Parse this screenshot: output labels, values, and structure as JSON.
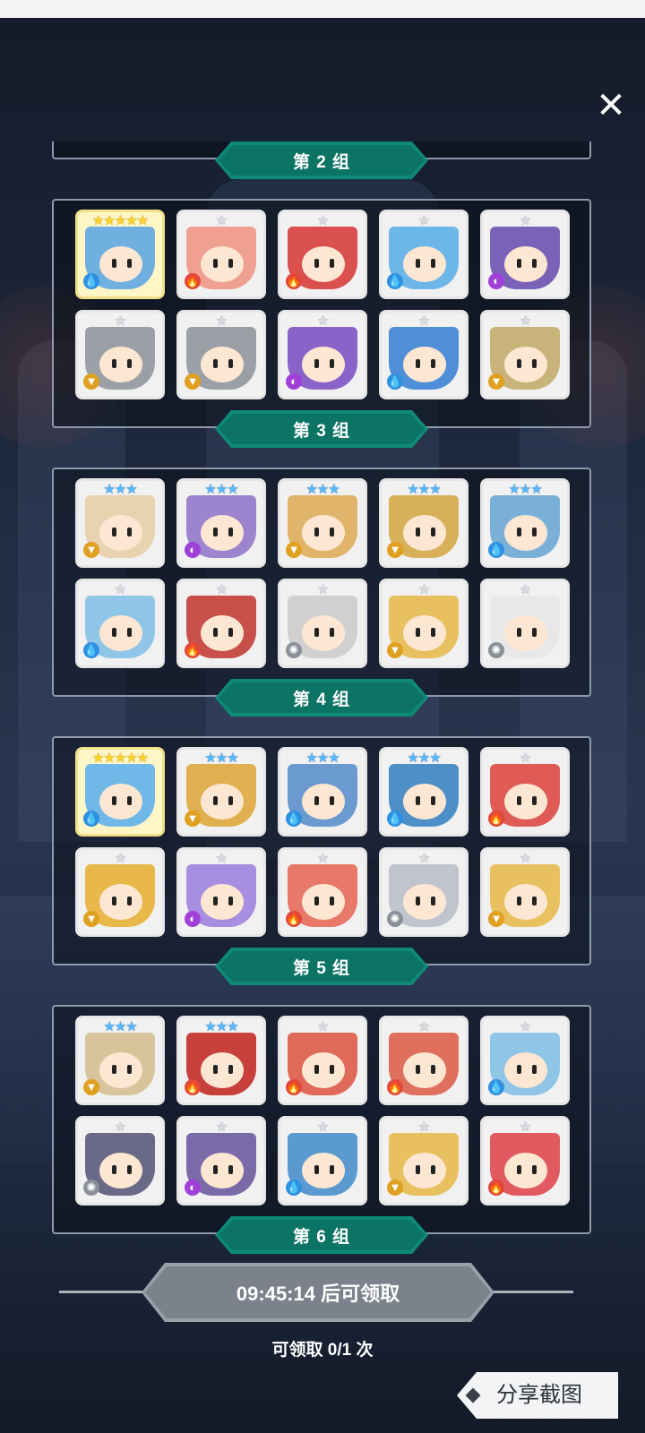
{
  "close_icon": "close-icon",
  "groups": [
    {
      "label": "第 2 组",
      "heroes": [
        {
          "stars": "★★★★★",
          "tier": "gold",
          "element": "water",
          "c": "#6fb0e0"
        },
        {
          "stars": "★",
          "tier": "silver",
          "element": "fire",
          "c": "#f0a090"
        },
        {
          "stars": "★",
          "tier": "silver",
          "element": "fire",
          "c": "#d9504e"
        },
        {
          "stars": "★",
          "tier": "silver",
          "element": "water",
          "c": "#6cb6e8"
        },
        {
          "stars": "★",
          "tier": "silver",
          "element": "dark",
          "c": "#7a62b8"
        },
        {
          "stars": "★",
          "tier": "silver",
          "element": "earth",
          "c": "#9aa0a6"
        },
        {
          "stars": "★",
          "tier": "silver",
          "element": "earth",
          "c": "#9aa0a6"
        },
        {
          "stars": "★",
          "tier": "silver",
          "element": "dark",
          "c": "#8a63c8"
        },
        {
          "stars": "★",
          "tier": "silver",
          "element": "water",
          "c": "#4f8fd8"
        },
        {
          "stars": "★",
          "tier": "silver",
          "element": "earth",
          "c": "#c8b47a"
        }
      ]
    },
    {
      "label": "第 3 组",
      "heroes": [
        {
          "stars": "★★★",
          "tier": "blue",
          "element": "earth",
          "c": "#e8d2b0"
        },
        {
          "stars": "★★★",
          "tier": "blue",
          "element": "dark",
          "c": "#9d84cf"
        },
        {
          "stars": "★★★",
          "tier": "blue",
          "element": "earth",
          "c": "#e0b46a"
        },
        {
          "stars": "★★★",
          "tier": "blue",
          "element": "earth",
          "c": "#d8b05a"
        },
        {
          "stars": "★★★",
          "tier": "blue",
          "element": "water",
          "c": "#7ab0d8"
        },
        {
          "stars": "★",
          "tier": "silver",
          "element": "water",
          "c": "#8fc6e8"
        },
        {
          "stars": "★",
          "tier": "silver",
          "element": "fire",
          "c": "#c8504a"
        },
        {
          "stars": "★",
          "tier": "silver",
          "element": "light",
          "c": "#d0d0d0"
        },
        {
          "stars": "★",
          "tier": "silver",
          "element": "earth",
          "c": "#e8c060"
        },
        {
          "stars": "★",
          "tier": "silver",
          "element": "light",
          "c": "#e8e8e8"
        }
      ]
    },
    {
      "label": "第 4 组",
      "heroes": [
        {
          "stars": "★★★★★",
          "tier": "gold",
          "element": "water",
          "c": "#70b8e8"
        },
        {
          "stars": "★★★",
          "tier": "blue",
          "element": "earth",
          "c": "#e0b050"
        },
        {
          "stars": "★★★",
          "tier": "blue",
          "element": "water",
          "c": "#6a9ad0"
        },
        {
          "stars": "★★★",
          "tier": "blue",
          "element": "water",
          "c": "#4f8fc8"
        },
        {
          "stars": "★",
          "tier": "silver",
          "element": "fire",
          "c": "#e05a56"
        },
        {
          "stars": "★",
          "tier": "silver",
          "element": "earth",
          "c": "#e8b84a"
        },
        {
          "stars": "★",
          "tier": "silver",
          "element": "dark",
          "c": "#a88ee0"
        },
        {
          "stars": "★",
          "tier": "silver",
          "element": "fire",
          "c": "#e8786a"
        },
        {
          "stars": "★",
          "tier": "silver",
          "element": "light",
          "c": "#c0c4cc"
        },
        {
          "stars": "★",
          "tier": "silver",
          "element": "earth",
          "c": "#e8c060"
        }
      ]
    },
    {
      "label": "第 5 组",
      "heroes": [
        {
          "stars": "★★★",
          "tier": "blue",
          "element": "earth",
          "c": "#d8c49a"
        },
        {
          "stars": "★★★",
          "tier": "blue",
          "element": "fire",
          "c": "#c8403c"
        },
        {
          "stars": "★",
          "tier": "silver",
          "element": "fire",
          "c": "#e06a5a"
        },
        {
          "stars": "★",
          "tier": "silver",
          "element": "fire",
          "c": "#e0705e"
        },
        {
          "stars": "★",
          "tier": "silver",
          "element": "water",
          "c": "#8fc6e8"
        },
        {
          "stars": "★",
          "tier": "silver",
          "element": "light",
          "c": "#6a6a88"
        },
        {
          "stars": "★",
          "tier": "silver",
          "element": "dark",
          "c": "#7a6aa8"
        },
        {
          "stars": "★",
          "tier": "silver",
          "element": "water",
          "c": "#5a9ad0"
        },
        {
          "stars": "★",
          "tier": "silver",
          "element": "earth",
          "c": "#e8c060"
        },
        {
          "stars": "★",
          "tier": "silver",
          "element": "fire",
          "c": "#e05a60"
        }
      ]
    }
  ],
  "next_group_label": "第 6 组",
  "claim": {
    "button_label": "09:45:14 后可领取",
    "count_label": "可领取 0/1 次"
  },
  "share": {
    "label": "分享截图"
  },
  "element_colors": {
    "water": "#2f8fe0",
    "fire": "#e0483a",
    "dark": "#a040d8",
    "earth": "#e0a020",
    "light": "#8a8f98"
  },
  "element_glyphs": {
    "water": "💧",
    "fire": "🔥",
    "dark": "◐",
    "earth": "▼",
    "light": "✺"
  }
}
